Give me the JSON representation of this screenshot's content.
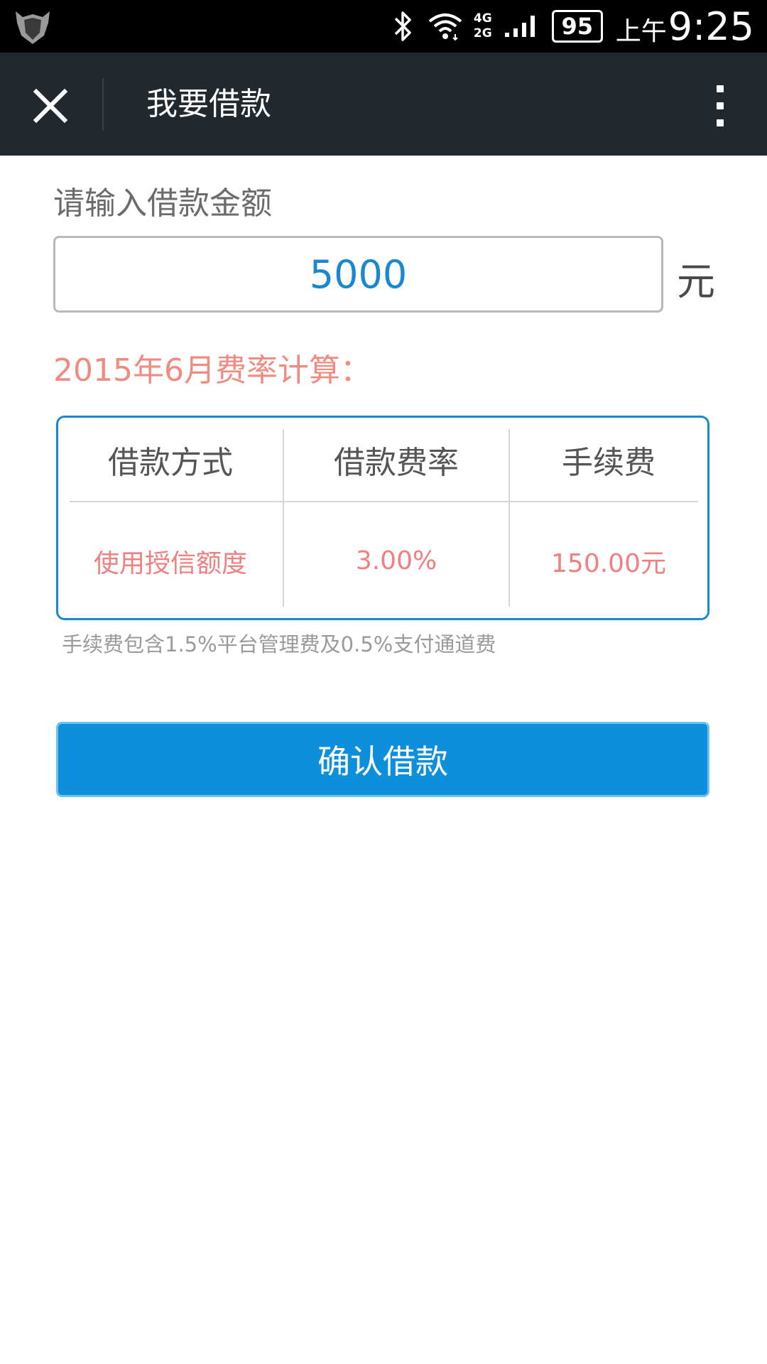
{
  "status_bar": {
    "network_top": "4G",
    "network_bottom": "2G",
    "battery": "95",
    "am_pm": "上午",
    "time": "9:25"
  },
  "title_bar": {
    "title": "我要借款"
  },
  "form": {
    "amount_label": "请输入借款金额",
    "amount_value": "5000",
    "amount_unit": "元",
    "rate_heading": "2015年6月费率计算："
  },
  "fee_table": {
    "headers": [
      "借款方式",
      "借款费率",
      "手续费"
    ],
    "row": [
      "使用授信额度",
      "3.00%",
      "150.00元"
    ]
  },
  "fee_note": "手续费包含1.5%平台管理费及0.5%支付通道费",
  "confirm_label": "确认借款",
  "colors": {
    "accent_blue": "#0e8fdc",
    "value_red": "#f08080",
    "title_bar_bg": "#22292e"
  }
}
